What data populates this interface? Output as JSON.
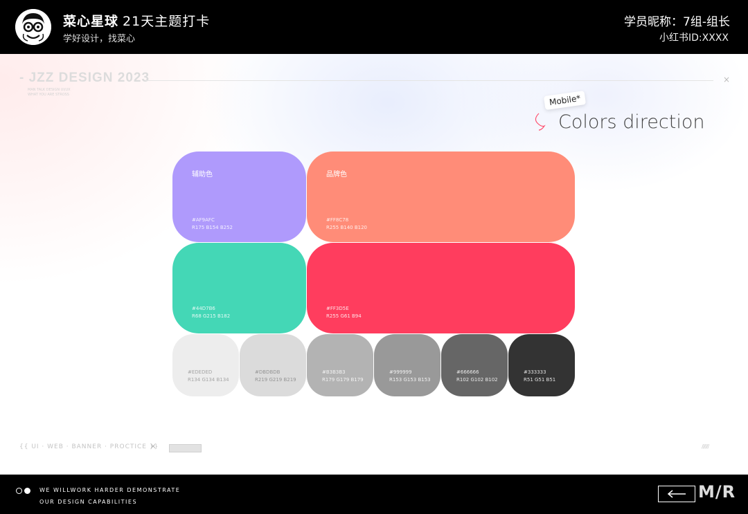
{
  "header": {
    "brand_name": "菜心星球",
    "event_title": "21天主题打卡",
    "tagline": "学好设计，找菜心",
    "nickname": "学员昵称：7组-组长",
    "xhs_id": "小红书ID:XXXX"
  },
  "canvas": {
    "brand_heading": "- JZZ DESIGN 2023",
    "brand_small_1": "MAN TALK DESIGN UI/UX",
    "brand_small_2": "WHAT YOU ARE STROSS",
    "close_glyph": "×",
    "mobile_tag": "Mobile*",
    "section_title": "Colors direction"
  },
  "swatches": {
    "assist": {
      "name": "辅助色",
      "hex": "#AF9AFC",
      "rgb": "R175  B154  B252"
    },
    "brand": {
      "name": "品牌色",
      "hex": "#FF8C78",
      "rgb": "R255  B140  B120"
    },
    "green": {
      "hex": "#44D7B6",
      "rgb": "R68  G215  B182"
    },
    "red": {
      "hex": "#FF3D5E",
      "rgb": "R255  G61  B94"
    },
    "grays": [
      {
        "hex": "#EDEDED",
        "rgb": "R134  G134  B134"
      },
      {
        "hex": "#DBDBDB",
        "rgb": "R219  G219  B219"
      },
      {
        "hex": "#B3B3B3",
        "rgb": "R179  G179  B179"
      },
      {
        "hex": "#999999",
        "rgb": "R153  G153  B153"
      },
      {
        "hex": "#666666",
        "rgb": "R102  G102  B102"
      },
      {
        "hex": "#333333",
        "rgb": "R51  G51  B51"
      }
    ]
  },
  "tags": {
    "line": "{{ UI · WEB · BANNER · PROCTICE }}",
    "separator": "×",
    "hatch": "//////"
  },
  "footer": {
    "line1": "WE WILLWORK HARDER DEMONSTRATE",
    "line2": "OUR DESIGN CAPABILITIES",
    "back_glyph": "⟵",
    "logo": "M/R"
  },
  "colors": {
    "header_bg": "#000000",
    "purple": "#AF9AFC",
    "salmon": "#FF8C78",
    "green": "#44D7B6",
    "red": "#FF3D5E"
  }
}
